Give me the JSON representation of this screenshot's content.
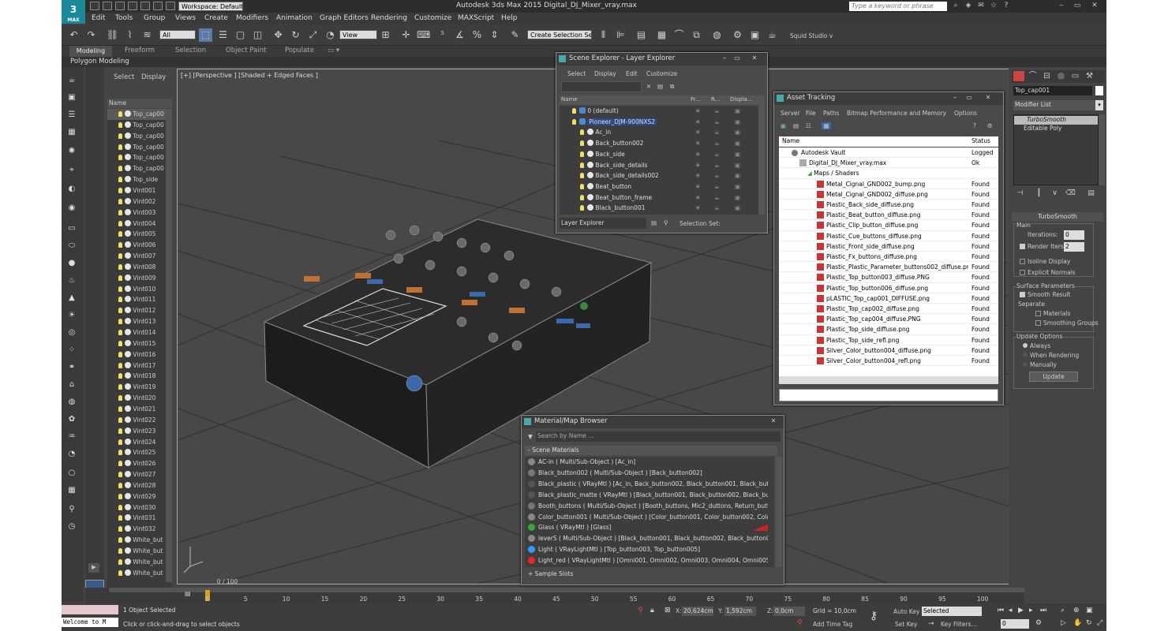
{
  "app": {
    "title": "Autodesk 3ds Max 2015     Digital_DJ_Mixer_vray.max",
    "logo": "3",
    "logo_sub": "MAX",
    "workspace": "Workspace: Default",
    "search_placeholder": "Type a keyword or phrase"
  },
  "menus": [
    "Edit",
    "Tools",
    "Group",
    "Views",
    "Create",
    "Modifiers",
    "Animation",
    "Graph Editors",
    "Rendering",
    "Customize",
    "MAXScript",
    "Help"
  ],
  "toolbar": {
    "filter": "All",
    "view": "View",
    "selection_set": "Create Selection Se",
    "studio": "Squid Studio v"
  },
  "ribbon": {
    "tabs": [
      "Modeling",
      "Freeform",
      "Selection",
      "Object Paint",
      "Populate"
    ],
    "sub": "Polygon Modeling"
  },
  "scene_panel": {
    "tabs": [
      "Select",
      "Display"
    ],
    "column": "Name",
    "items": [
      "Top_cap00",
      "Top_cap00",
      "Top_cap00",
      "Top_cap00",
      "Top_cap00",
      "Top_cap00",
      "Top_side",
      "Vint001",
      "Vint002",
      "Vint003",
      "Vint004",
      "Vint005",
      "Vint006",
      "Vint007",
      "Vint008",
      "Vint009",
      "Vint010",
      "Vint011",
      "Vint012",
      "Vint013",
      "Vint014",
      "Vint015",
      "Vint016",
      "Vint017",
      "Vint018",
      "Vint019",
      "Vint020",
      "Vint021",
      "Vint022",
      "Vint023",
      "Vint024",
      "Vint025",
      "Vint026",
      "Vint027",
      "Vint028",
      "Vint029",
      "Vint030",
      "Vint031",
      "Vint032",
      "White_but",
      "White_but",
      "White_but",
      "White_but"
    ]
  },
  "viewport": {
    "label": "[+] [Perspective ] [Shaded + Edged Faces ]"
  },
  "layer_explorer": {
    "title": "Scene Explorer - Layer Explorer",
    "menus": [
      "Select",
      "Display",
      "Edit",
      "Customize"
    ],
    "columns": [
      "Name",
      "Fr...",
      "R...",
      "Displa..."
    ],
    "rows": [
      "0 (default)",
      "Pioneer_DJM-900NXS2",
      "Ac_in",
      "Back_button002",
      "Back_side",
      "Back_side_details",
      "Back_side_details002",
      "Beat_button",
      "Beat_button_frame",
      "Black_button001"
    ],
    "footer_left": "Layer Explorer",
    "footer_right": "Selection Set:"
  },
  "asset_tracking": {
    "title": "Asset Tracking",
    "menus": [
      "Server",
      "File",
      "Paths",
      "Bitmap Performance and Memory",
      "Options"
    ],
    "columns": [
      "Name",
      "Status"
    ],
    "vault": "Autodesk Vault",
    "vault_status": "Logged",
    "file": "Digital_DJ_Mixer_vray.max",
    "file_status": "Ok",
    "group": "Maps / Shaders",
    "maps": [
      "Metal_Cignal_GND002_bump.png",
      "Metal_Cignal_GND002_diffuse.png",
      "Plastic_Back_side_diffuse.png",
      "Plastic_Beat_button_diffuse.png",
      "Plastic_Clip_button_diffuse.png",
      "Plastic_Cue_buttons_diffuse.png",
      "Plastic_Front_side_diffuse.png",
      "Plastic_Fx_buttons_diffuse.png",
      "Plastic_Plastic_Parameter_buttons002_diffuse.png",
      "Plastic_Top_button003_diffuse.PNG",
      "Plastic_Top_button006_diffuse.png",
      "pLASTIC_Top_cap001_DIFFUSE.png",
      "Plastic_Top_cap002_diffuse.png",
      "Plastic_Top_cap004_diffuse.PNG",
      "Plastic_Top_side_diffuse.png",
      "Plastic_Top_side_refl.png",
      "Silver_Color_button004_diffuse.png",
      "Silver_Color_button004_refl.png"
    ],
    "map_status": "Found"
  },
  "material_browser": {
    "title": "Material/Map Browser",
    "search": "Search by Name ...",
    "section": "- Scene Materials",
    "materials": [
      "AC-in  ( Multi/Sub-Object ) [Ac_in]",
      "Black_button002  ( Multi/Sub-Object ) [Back_button002]",
      "Black_plastic  ( VRayMtl ) [Ac_in, Back_button002, Black_button001, Black_butt...",
      "Black_plastic_matte  ( VRayMtl ) [Black_button001, Black_button002, Black_butt...",
      "Booth_buttons  ( Multi/Sub-Object ) [Booth_buttons, Mic2_duttons, Return_butt...",
      "Color_button001  ( Multi/Sub-Object ) [Color_button001, Color_button002, Color...",
      "Glass  ( VRayMtl ) [Glass]",
      "leverS  ( Multi/Sub-Object ) [Black_button001, Black_button002, Black_button00...",
      "Light  ( VRayLightMtl ) [Top_button003, Top_button005]",
      "Light_red  ( VRayLightMtl ) [Omni001, Omni002, Omni003, Omni004, Omni005,..."
    ],
    "footer": "+ Sample Slots"
  },
  "command_panel": {
    "object": "Top_cap001",
    "modifier_list": "Modifier List",
    "stack": [
      "TurboSmooth",
      "Editable Poly"
    ],
    "rollout": "TurboSmooth",
    "main": "Main",
    "iterations_label": "Iterations:",
    "iterations": "0",
    "render_iters_label": "Render Iters:",
    "render_iters": "2",
    "isoline": "Isoline Display",
    "explicit": "Explicit Normals",
    "surface": "Surface Parameters",
    "smooth": "Smooth Result",
    "separate": "Separate",
    "materials": "Materials",
    "smoothing": "Smoothing Groups",
    "update_options": "Update Options",
    "always": "Always",
    "when_rendering": "When Rendering",
    "manually": "Manually",
    "update": "Update"
  },
  "timeline": {
    "frame": "0 / 100",
    "ticks": [
      "0",
      "5",
      "10",
      "15",
      "20",
      "25",
      "30",
      "35",
      "40",
      "45",
      "50",
      "55",
      "60",
      "65",
      "70",
      "75",
      "80",
      "85",
      "90",
      "95",
      "100"
    ]
  },
  "status": {
    "welcome": "Welcome to M",
    "selected": "1 Object Selected",
    "hint": "Click or click-and-drag to select objects",
    "x_label": "X:",
    "x": "20,624cm",
    "y_label": "Y:",
    "y": "1,592cm",
    "z_label": "Z:",
    "z": "0,0cm",
    "grid": "Grid = 10,0cm",
    "add_time_tag": "Add Time Tag",
    "auto_key": "Auto Key",
    "set_key": "Set Key",
    "selected_dd": "Selected",
    "key_filters": "Key Filters...",
    "frame_field": "0"
  },
  "colors": {
    "accent": "#1a8a9a",
    "selection": "#2a4a8a",
    "timeline_orange": "#d4a020"
  }
}
